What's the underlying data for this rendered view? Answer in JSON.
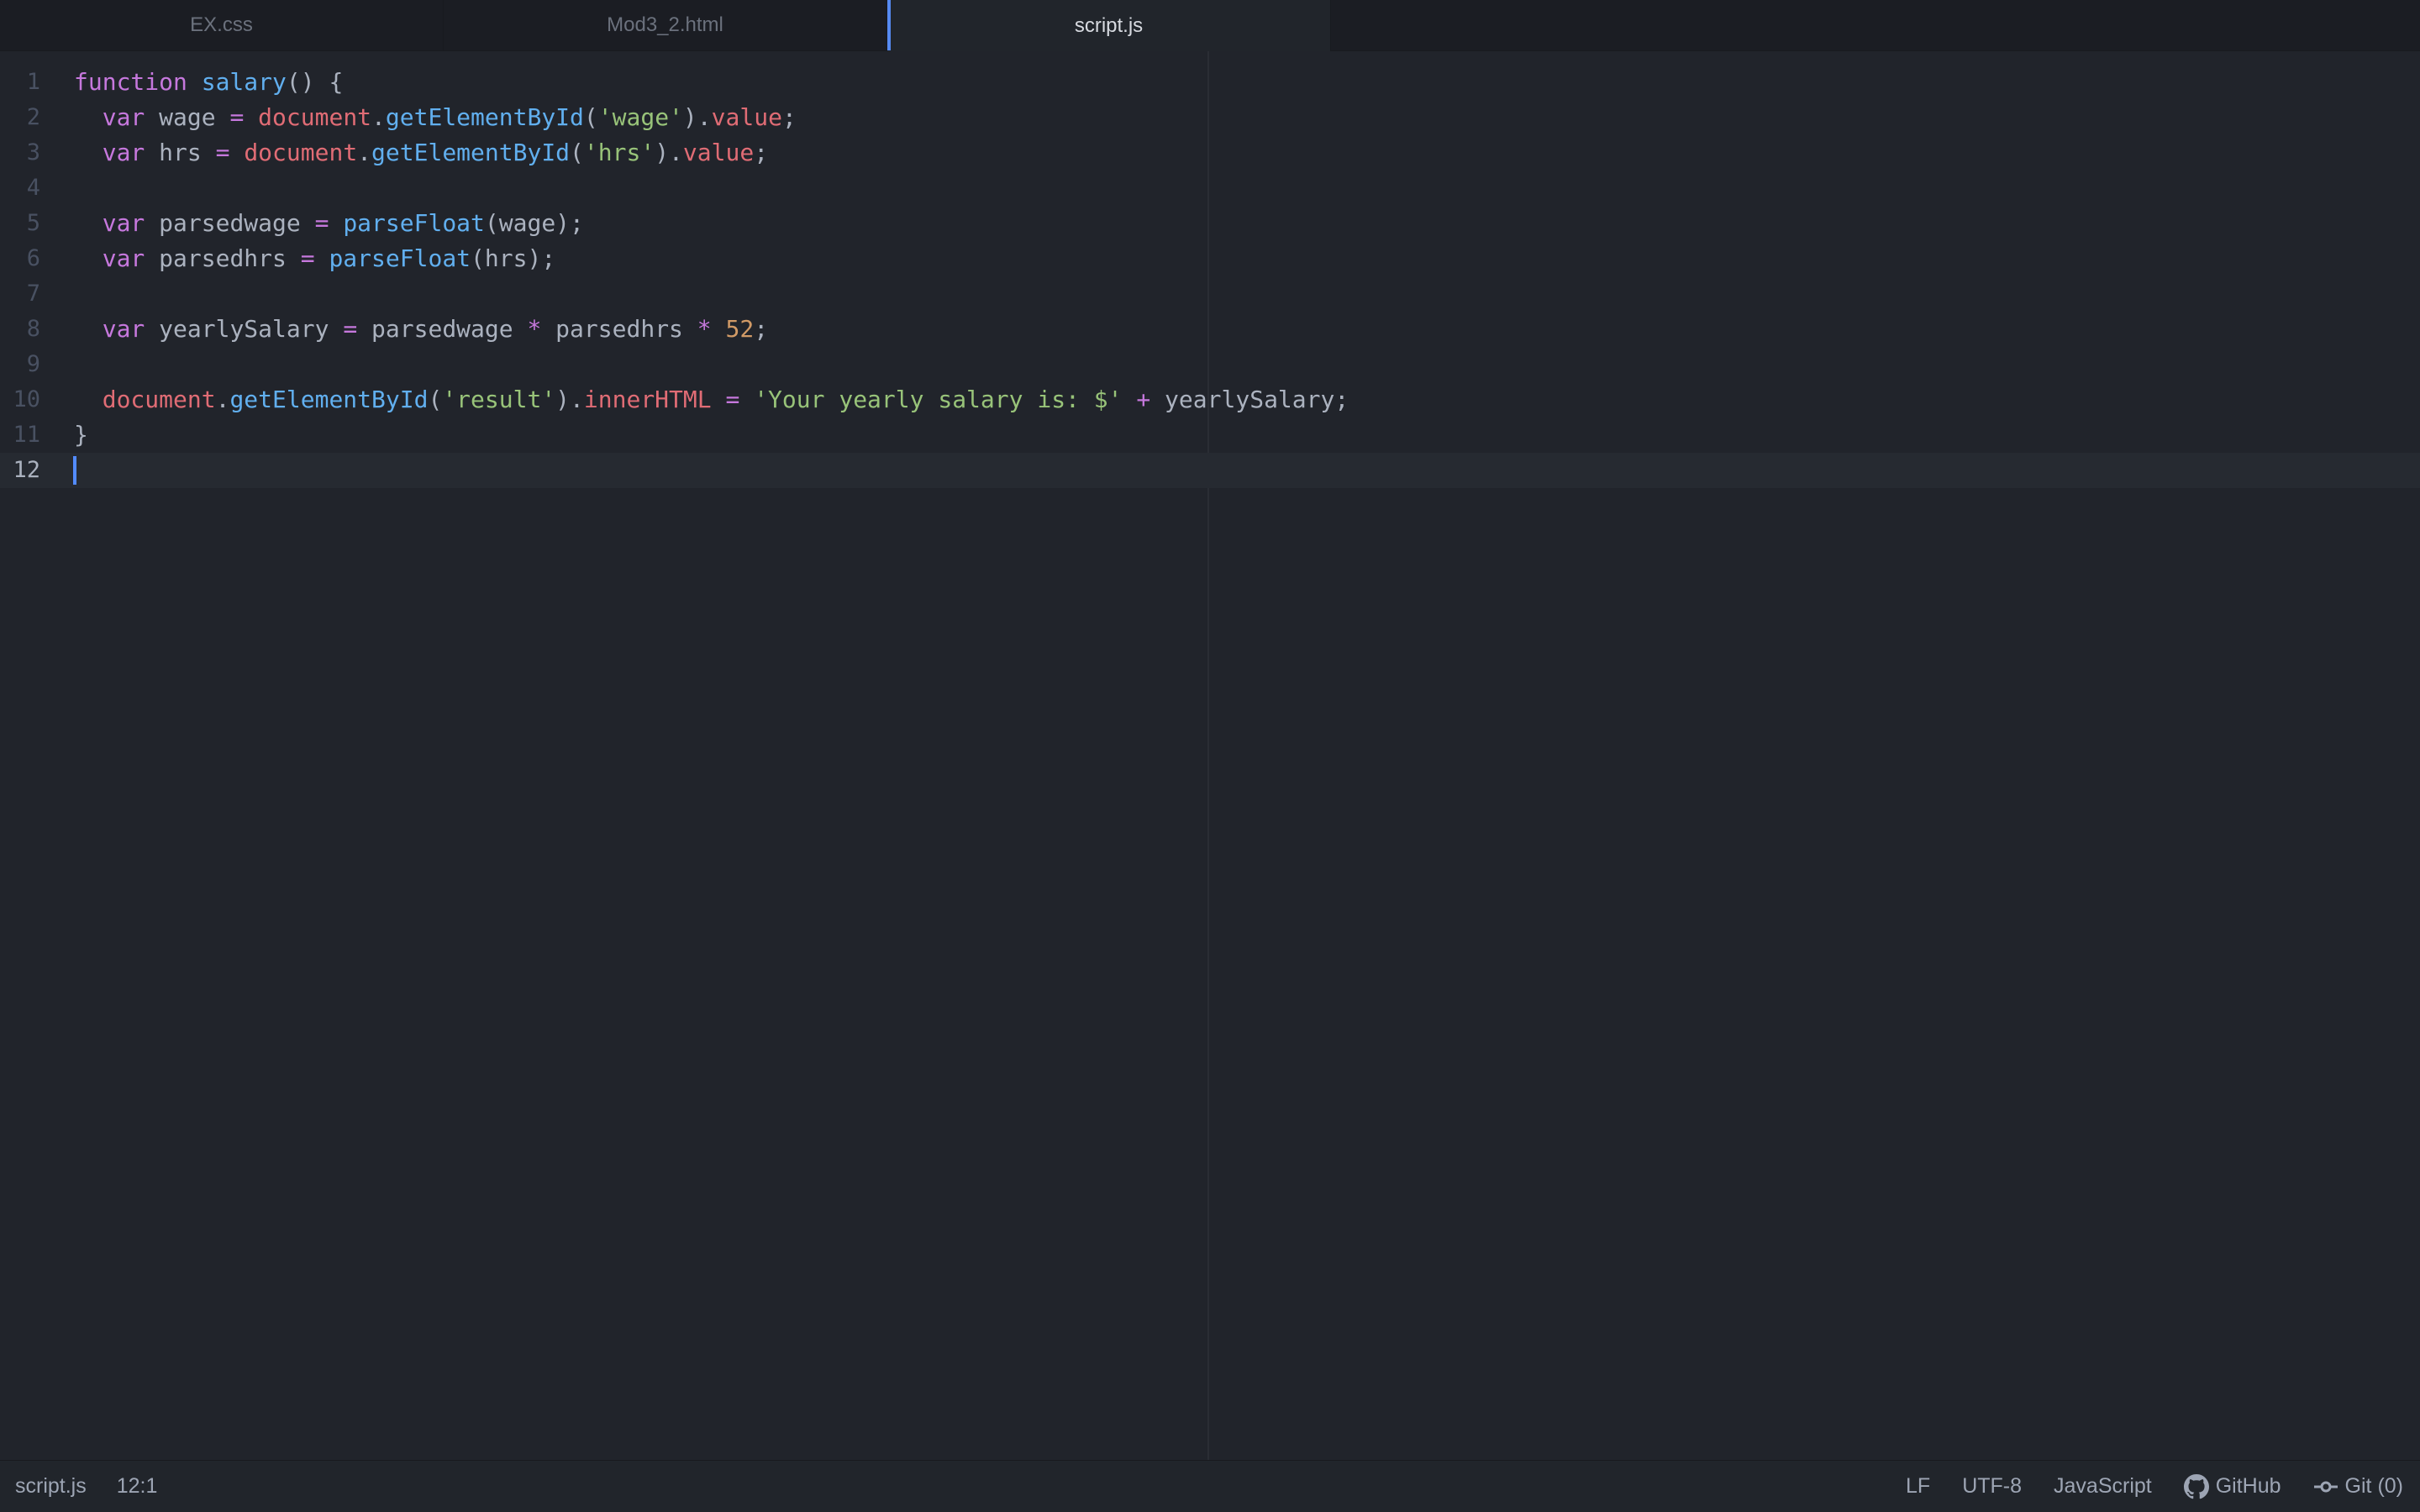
{
  "tabs": [
    {
      "label": "EX.css",
      "active": false
    },
    {
      "label": "Mod3_2.html",
      "active": false
    },
    {
      "label": "script.js",
      "active": true
    }
  ],
  "editor": {
    "cursor_line": 12,
    "lines": [
      {
        "n": "1",
        "tokens": [
          [
            "kw",
            "function"
          ],
          [
            "pl",
            " "
          ],
          [
            "fn",
            "salary"
          ],
          [
            "pl",
            "() {"
          ]
        ]
      },
      {
        "n": "2",
        "tokens": [
          [
            "pl",
            "  "
          ],
          [
            "kw",
            "var"
          ],
          [
            "pl",
            " wage "
          ],
          [
            "op",
            "="
          ],
          [
            "pl",
            " "
          ],
          [
            "obj",
            "document"
          ],
          [
            "pl",
            "."
          ],
          [
            "fn",
            "getElementById"
          ],
          [
            "pl",
            "("
          ],
          [
            "str",
            "'wage'"
          ],
          [
            "pl",
            ")."
          ],
          [
            "obj",
            "value"
          ],
          [
            "pl",
            ";"
          ]
        ]
      },
      {
        "n": "3",
        "tokens": [
          [
            "pl",
            "  "
          ],
          [
            "kw",
            "var"
          ],
          [
            "pl",
            " hrs "
          ],
          [
            "op",
            "="
          ],
          [
            "pl",
            " "
          ],
          [
            "obj",
            "document"
          ],
          [
            "pl",
            "."
          ],
          [
            "fn",
            "getElementById"
          ],
          [
            "pl",
            "("
          ],
          [
            "str",
            "'hrs'"
          ],
          [
            "pl",
            ")."
          ],
          [
            "obj",
            "value"
          ],
          [
            "pl",
            ";"
          ]
        ]
      },
      {
        "n": "4",
        "tokens": []
      },
      {
        "n": "5",
        "tokens": [
          [
            "pl",
            "  "
          ],
          [
            "kw",
            "var"
          ],
          [
            "pl",
            " parsedwage "
          ],
          [
            "op",
            "="
          ],
          [
            "pl",
            " "
          ],
          [
            "fn",
            "parseFloat"
          ],
          [
            "pl",
            "(wage);"
          ]
        ]
      },
      {
        "n": "6",
        "tokens": [
          [
            "pl",
            "  "
          ],
          [
            "kw",
            "var"
          ],
          [
            "pl",
            " parsedhrs "
          ],
          [
            "op",
            "="
          ],
          [
            "pl",
            " "
          ],
          [
            "fn",
            "parseFloat"
          ],
          [
            "pl",
            "(hrs);"
          ]
        ]
      },
      {
        "n": "7",
        "tokens": []
      },
      {
        "n": "8",
        "tokens": [
          [
            "pl",
            "  "
          ],
          [
            "kw",
            "var"
          ],
          [
            "pl",
            " yearlySalary "
          ],
          [
            "op",
            "="
          ],
          [
            "pl",
            " parsedwage "
          ],
          [
            "op",
            "*"
          ],
          [
            "pl",
            " parsedhrs "
          ],
          [
            "op",
            "*"
          ],
          [
            "pl",
            " "
          ],
          [
            "num",
            "52"
          ],
          [
            "pl",
            ";"
          ]
        ]
      },
      {
        "n": "9",
        "tokens": []
      },
      {
        "n": "10",
        "tokens": [
          [
            "pl",
            "  "
          ],
          [
            "obj",
            "document"
          ],
          [
            "pl",
            "."
          ],
          [
            "fn",
            "getElementById"
          ],
          [
            "pl",
            "("
          ],
          [
            "str",
            "'result'"
          ],
          [
            "pl",
            ")."
          ],
          [
            "obj",
            "innerHTML"
          ],
          [
            "pl",
            " "
          ],
          [
            "op",
            "="
          ],
          [
            "pl",
            " "
          ],
          [
            "str",
            "'Your yearly salary is: $'"
          ],
          [
            "pl",
            " "
          ],
          [
            "op",
            "+"
          ],
          [
            "pl",
            " yearlySalary;"
          ]
        ]
      },
      {
        "n": "11",
        "tokens": [
          [
            "pl",
            "}"
          ]
        ]
      },
      {
        "n": "12",
        "tokens": []
      }
    ]
  },
  "status": {
    "file": "script.js",
    "position": "12:1",
    "line_ending": "LF",
    "encoding": "UTF-8",
    "grammar": "JavaScript",
    "github": "GitHub",
    "git": "Git (0)"
  },
  "colors": {
    "accent": "#568af2",
    "keyword": "#c678dd",
    "function": "#61afef",
    "object": "#e06c75",
    "string": "#98c379",
    "number": "#d19a66"
  }
}
